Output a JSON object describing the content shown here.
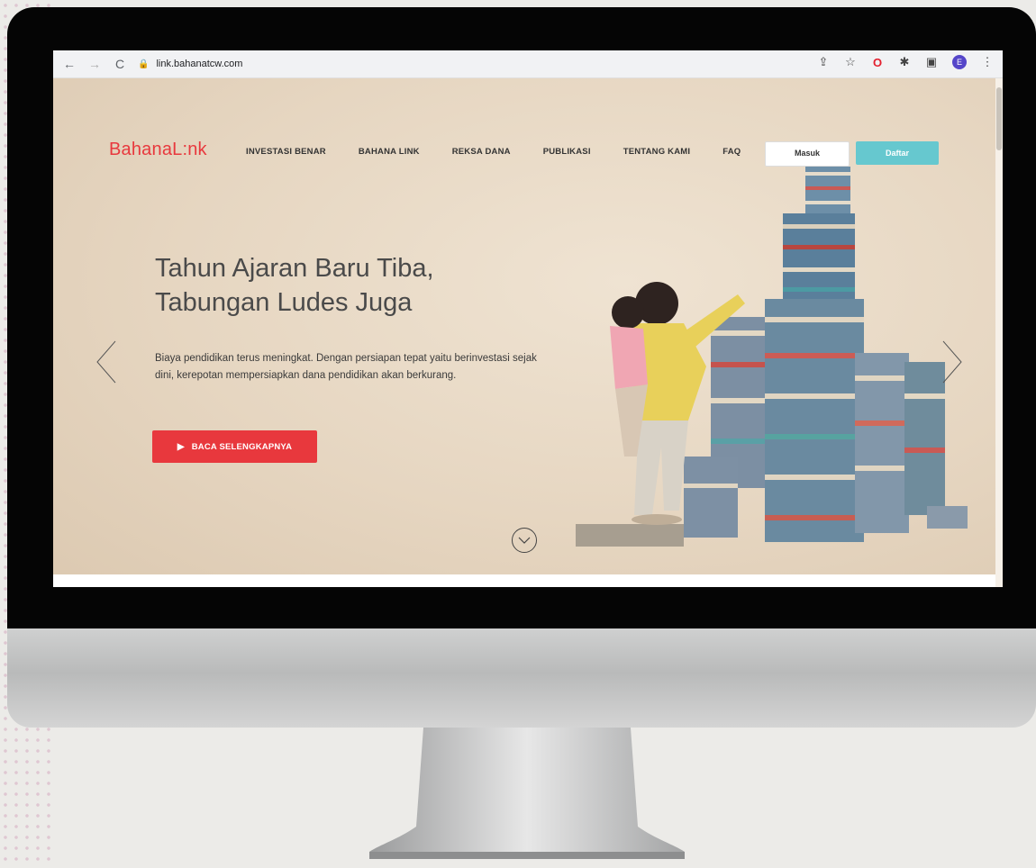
{
  "browser": {
    "url": "link.bahanatcw.com",
    "profile_initial": "E",
    "icons": [
      "share-icon",
      "star-icon",
      "opera-icon",
      "extensions-icon",
      "sidepanel-icon",
      "profile-icon",
      "menu-icon"
    ]
  },
  "site": {
    "logo": "BahanaL:nk",
    "nav": [
      "INVESTASI BENAR",
      "BAHANA LINK",
      "REKSA DANA",
      "PUBLIKASI",
      "TENTANG KAMI",
      "FAQ"
    ],
    "login_label": "Masuk",
    "register_label": "Daftar",
    "colors": {
      "brand_red": "#e8383d",
      "accent_teal": "#66c8cf"
    }
  },
  "hero": {
    "title_line1": "Tahun Ajaran Baru Tiba,",
    "title_line2": "Tabungan Ludes Juga",
    "description": "Biaya pendidikan terus meningkat. Dengan persiapan tepat yaitu berinvestasi sejak dini, kerepotan mempersiapkan dana pendidikan akan berkurang.",
    "cta_label": "BACA SELENGKAPNYA"
  }
}
